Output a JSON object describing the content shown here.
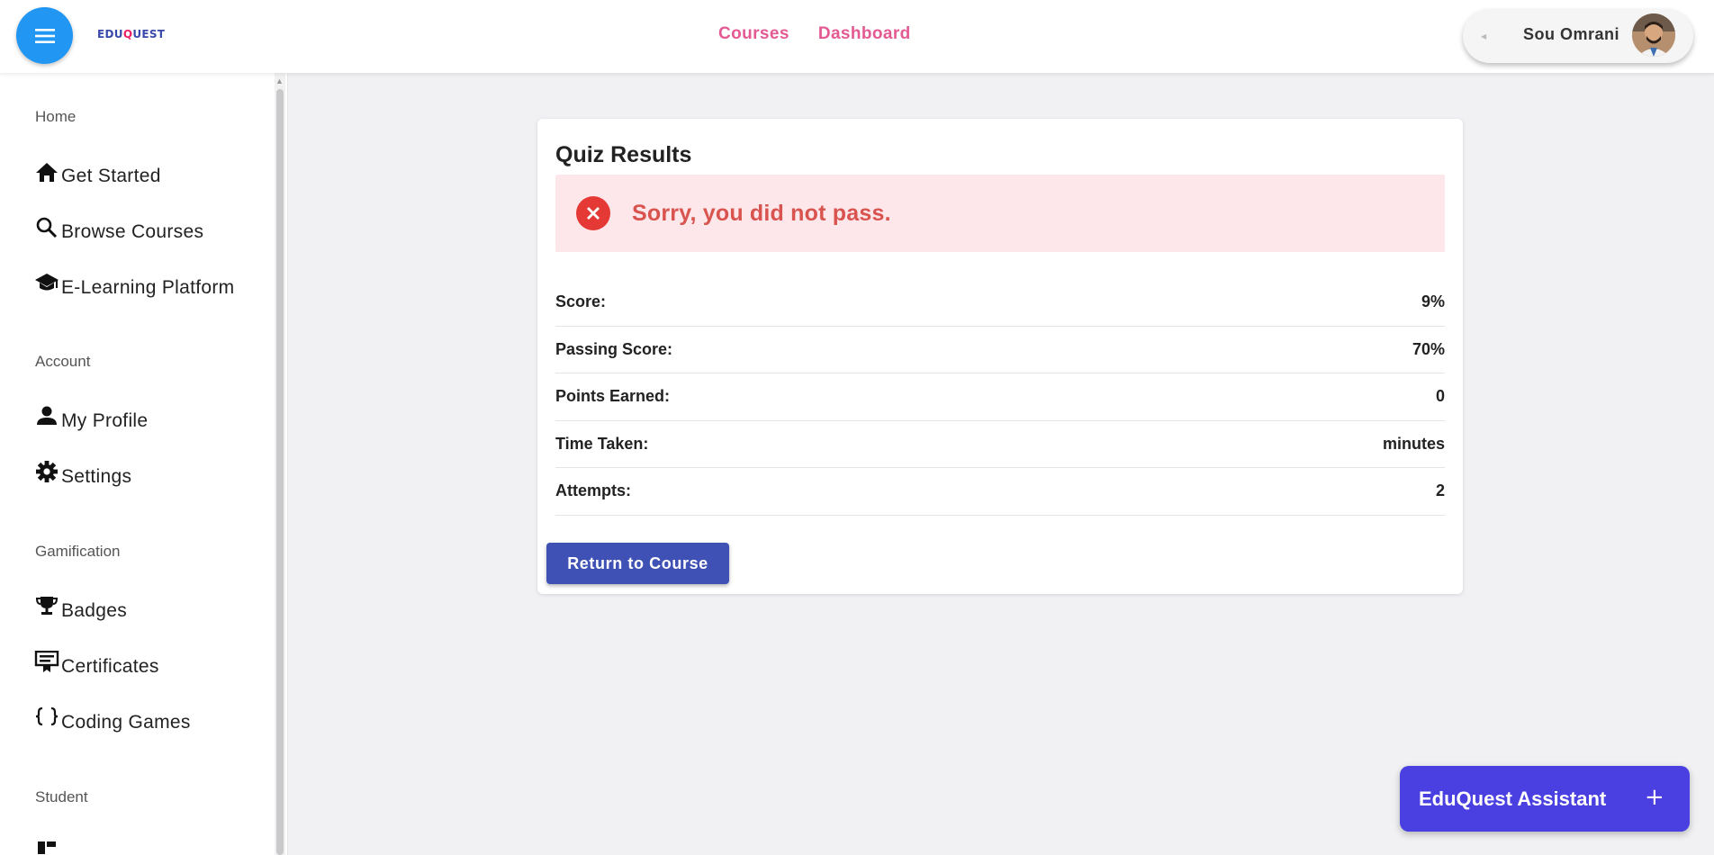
{
  "header": {
    "logo_prefix": "EDU",
    "logo_q": "Q",
    "logo_suffix": "UEST",
    "nav": [
      "Courses",
      "Dashboard"
    ],
    "user_name": "Sou Omrani"
  },
  "sidebar": {
    "sections": [
      {
        "title": "Home",
        "items": [
          {
            "label": "Get Started",
            "icon": "home-icon"
          },
          {
            "label": "Browse Courses",
            "icon": "search-icon"
          },
          {
            "label": "E-Learning Platform",
            "icon": "school-icon"
          }
        ]
      },
      {
        "title": "Account",
        "items": [
          {
            "label": "My Profile",
            "icon": "person-icon"
          },
          {
            "label": "Settings",
            "icon": "gear-icon"
          }
        ]
      },
      {
        "title": "Gamification",
        "items": [
          {
            "label": "Badges",
            "icon": "trophy-icon"
          },
          {
            "label": "Certificates",
            "icon": "certificate-icon"
          },
          {
            "label": "Coding Games",
            "icon": "braces-icon"
          }
        ]
      },
      {
        "title": "Student",
        "items": []
      }
    ]
  },
  "quiz": {
    "title": "Quiz Results",
    "alert_message": "Sorry, you did not pass.",
    "rows": [
      {
        "label": "Score:",
        "value": "9%"
      },
      {
        "label": "Passing Score:",
        "value": "70%"
      },
      {
        "label": "Points Earned:",
        "value": "0"
      },
      {
        "label": "Time Taken:",
        "value": "minutes"
      },
      {
        "label": "Attempts:",
        "value": "2"
      }
    ],
    "return_button": "Return to Course"
  },
  "assistant": {
    "label": "EduQuest Assistant",
    "toggle": "+"
  },
  "colors": {
    "menu_button": "#2196f3",
    "nav_link": "#e35a93",
    "primary_button": "#3f51b5",
    "error": "#e53935",
    "error_bg": "#fde7ea",
    "assistant": "#4a3fe0"
  }
}
